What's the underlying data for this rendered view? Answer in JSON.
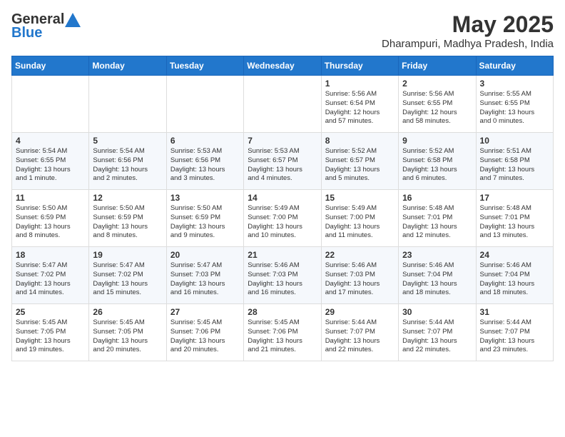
{
  "logo": {
    "general": "General",
    "blue": "Blue"
  },
  "title": "May 2025",
  "location": "Dharampuri, Madhya Pradesh, India",
  "days_of_week": [
    "Sunday",
    "Monday",
    "Tuesday",
    "Wednesday",
    "Thursday",
    "Friday",
    "Saturday"
  ],
  "weeks": [
    [
      {
        "day": "",
        "info": ""
      },
      {
        "day": "",
        "info": ""
      },
      {
        "day": "",
        "info": ""
      },
      {
        "day": "",
        "info": ""
      },
      {
        "day": "1",
        "info": "Sunrise: 5:56 AM\nSunset: 6:54 PM\nDaylight: 12 hours\nand 57 minutes."
      },
      {
        "day": "2",
        "info": "Sunrise: 5:56 AM\nSunset: 6:55 PM\nDaylight: 12 hours\nand 58 minutes."
      },
      {
        "day": "3",
        "info": "Sunrise: 5:55 AM\nSunset: 6:55 PM\nDaylight: 13 hours\nand 0 minutes."
      }
    ],
    [
      {
        "day": "4",
        "info": "Sunrise: 5:54 AM\nSunset: 6:55 PM\nDaylight: 13 hours\nand 1 minute."
      },
      {
        "day": "5",
        "info": "Sunrise: 5:54 AM\nSunset: 6:56 PM\nDaylight: 13 hours\nand 2 minutes."
      },
      {
        "day": "6",
        "info": "Sunrise: 5:53 AM\nSunset: 6:56 PM\nDaylight: 13 hours\nand 3 minutes."
      },
      {
        "day": "7",
        "info": "Sunrise: 5:53 AM\nSunset: 6:57 PM\nDaylight: 13 hours\nand 4 minutes."
      },
      {
        "day": "8",
        "info": "Sunrise: 5:52 AM\nSunset: 6:57 PM\nDaylight: 13 hours\nand 5 minutes."
      },
      {
        "day": "9",
        "info": "Sunrise: 5:52 AM\nSunset: 6:58 PM\nDaylight: 13 hours\nand 6 minutes."
      },
      {
        "day": "10",
        "info": "Sunrise: 5:51 AM\nSunset: 6:58 PM\nDaylight: 13 hours\nand 7 minutes."
      }
    ],
    [
      {
        "day": "11",
        "info": "Sunrise: 5:50 AM\nSunset: 6:59 PM\nDaylight: 13 hours\nand 8 minutes."
      },
      {
        "day": "12",
        "info": "Sunrise: 5:50 AM\nSunset: 6:59 PM\nDaylight: 13 hours\nand 8 minutes."
      },
      {
        "day": "13",
        "info": "Sunrise: 5:50 AM\nSunset: 6:59 PM\nDaylight: 13 hours\nand 9 minutes."
      },
      {
        "day": "14",
        "info": "Sunrise: 5:49 AM\nSunset: 7:00 PM\nDaylight: 13 hours\nand 10 minutes."
      },
      {
        "day": "15",
        "info": "Sunrise: 5:49 AM\nSunset: 7:00 PM\nDaylight: 13 hours\nand 11 minutes."
      },
      {
        "day": "16",
        "info": "Sunrise: 5:48 AM\nSunset: 7:01 PM\nDaylight: 13 hours\nand 12 minutes."
      },
      {
        "day": "17",
        "info": "Sunrise: 5:48 AM\nSunset: 7:01 PM\nDaylight: 13 hours\nand 13 minutes."
      }
    ],
    [
      {
        "day": "18",
        "info": "Sunrise: 5:47 AM\nSunset: 7:02 PM\nDaylight: 13 hours\nand 14 minutes."
      },
      {
        "day": "19",
        "info": "Sunrise: 5:47 AM\nSunset: 7:02 PM\nDaylight: 13 hours\nand 15 minutes."
      },
      {
        "day": "20",
        "info": "Sunrise: 5:47 AM\nSunset: 7:03 PM\nDaylight: 13 hours\nand 16 minutes."
      },
      {
        "day": "21",
        "info": "Sunrise: 5:46 AM\nSunset: 7:03 PM\nDaylight: 13 hours\nand 16 minutes."
      },
      {
        "day": "22",
        "info": "Sunrise: 5:46 AM\nSunset: 7:03 PM\nDaylight: 13 hours\nand 17 minutes."
      },
      {
        "day": "23",
        "info": "Sunrise: 5:46 AM\nSunset: 7:04 PM\nDaylight: 13 hours\nand 18 minutes."
      },
      {
        "day": "24",
        "info": "Sunrise: 5:46 AM\nSunset: 7:04 PM\nDaylight: 13 hours\nand 18 minutes."
      }
    ],
    [
      {
        "day": "25",
        "info": "Sunrise: 5:45 AM\nSunset: 7:05 PM\nDaylight: 13 hours\nand 19 minutes."
      },
      {
        "day": "26",
        "info": "Sunrise: 5:45 AM\nSunset: 7:05 PM\nDaylight: 13 hours\nand 20 minutes."
      },
      {
        "day": "27",
        "info": "Sunrise: 5:45 AM\nSunset: 7:06 PM\nDaylight: 13 hours\nand 20 minutes."
      },
      {
        "day": "28",
        "info": "Sunrise: 5:45 AM\nSunset: 7:06 PM\nDaylight: 13 hours\nand 21 minutes."
      },
      {
        "day": "29",
        "info": "Sunrise: 5:44 AM\nSunset: 7:07 PM\nDaylight: 13 hours\nand 22 minutes."
      },
      {
        "day": "30",
        "info": "Sunrise: 5:44 AM\nSunset: 7:07 PM\nDaylight: 13 hours\nand 22 minutes."
      },
      {
        "day": "31",
        "info": "Sunrise: 5:44 AM\nSunset: 7:07 PM\nDaylight: 13 hours\nand 23 minutes."
      }
    ]
  ]
}
